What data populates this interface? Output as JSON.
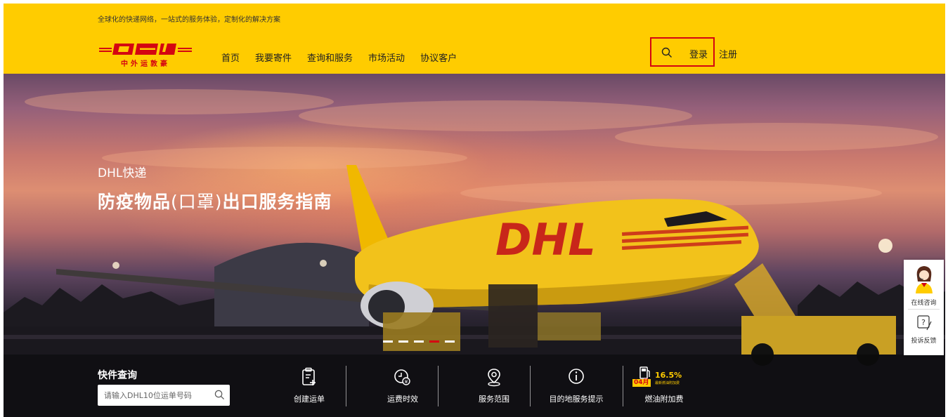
{
  "header": {
    "tagline": "全球化的快递网络，一站式的服务体验，定制化的解决方案",
    "logo_text": "中外运敦豪",
    "nav": [
      "首页",
      "我要寄件",
      "查询和服务",
      "市场活动",
      "协议客户"
    ],
    "login_label": "登录",
    "register_label": "注册"
  },
  "hero": {
    "subtitle": "DHL快递",
    "title_part1": "防疫物品",
    "title_part2": "(口罩)",
    "title_part3": "出口服务指南",
    "plane_brand": "DHL",
    "slides": [
      false,
      false,
      false,
      true,
      false
    ]
  },
  "tracking": {
    "label": "快件查询",
    "placeholder": "请输入DHL10位运单号码"
  },
  "quick_links": [
    {
      "label": "创建运单",
      "icon": "create-waybill-icon"
    },
    {
      "label": "运费时效",
      "icon": "clock-rate-icon"
    },
    {
      "label": "服务范围",
      "icon": "location-pin-icon"
    },
    {
      "label": "目的地服务提示",
      "icon": "info-icon"
    },
    {
      "label": "燃油附加费",
      "icon": "fuel-icon"
    }
  ],
  "fuel": {
    "month": "04月",
    "percent": "16.5%",
    "note": "最新燃油附加费"
  },
  "side": {
    "chat_label": "在线咨询",
    "feedback_label": "投诉反馈",
    "feedback_glyph": "?"
  },
  "colors": {
    "brand_yellow": "#ffcc00",
    "brand_red": "#d40511"
  }
}
